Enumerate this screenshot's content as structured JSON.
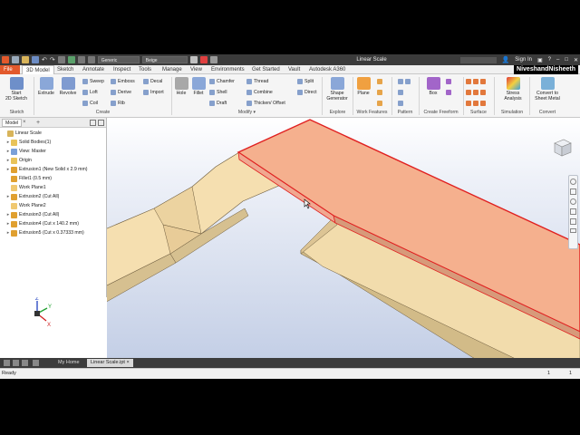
{
  "titlebar": {
    "material": "Generic",
    "appearance": "Beige",
    "doc_title": "Linear Scale",
    "sign_in": "Sign In"
  },
  "tabs": {
    "file": "File",
    "items": [
      "3D Model",
      "Sketch",
      "Annotate",
      "Inspect",
      "Tools",
      "Manage",
      "View",
      "Environments",
      "Get Started",
      "Vault",
      "Autodesk A360"
    ],
    "user": "NiveshandNisheeth"
  },
  "ribbon": {
    "start_sketch": "Start\n2D Sketch",
    "extrude": "Extrude",
    "revolve": "Revolve",
    "sweep": "Sweep",
    "loft": "Loft",
    "coil": "Coil",
    "emboss": "Emboss",
    "derive": "Derive",
    "rib": "Rib",
    "decal": "Decal",
    "import": "Import",
    "hole": "Hole",
    "fillet": "Fillet",
    "chamfer": "Chamfer",
    "shell": "Shell",
    "draft": "Draft",
    "thread": "Thread",
    "combine": "Combine",
    "thicken": "Thicken/ Offset",
    "split": "Split",
    "direct": "Direct",
    "shape_generator": "Shape\nGenerator",
    "plane": "Plane",
    "box": "Box",
    "stress": "Stress\nAnalysis",
    "convert": "Convert to\nSheet Metal",
    "panels": {
      "sketch": "Sketch",
      "create": "Create",
      "modify": "Modify ▾",
      "explore": "Explore",
      "work_features": "Work Features",
      "pattern": "Pattern",
      "freeform": "Create Freeform",
      "surface": "Surface",
      "simulation": "Simulation",
      "convert": "Convert"
    }
  },
  "browser": {
    "tab": "Model",
    "tree": [
      {
        "label": "Linear Scale",
        "indent": 0,
        "icon": "part",
        "expander": ""
      },
      {
        "label": "Solid Bodies(1)",
        "indent": 1,
        "icon": "folder",
        "expander": "▸"
      },
      {
        "label": "View: Master",
        "indent": 1,
        "icon": "view",
        "expander": "▸"
      },
      {
        "label": "Origin",
        "indent": 1,
        "icon": "folder",
        "expander": "▸"
      },
      {
        "label": "Extrusion1 (New Solid x 2.9 mm)",
        "indent": 1,
        "icon": "feature",
        "expander": "▸"
      },
      {
        "label": "Fillet1 (0.5 mm)",
        "indent": 1,
        "icon": "feature",
        "expander": ""
      },
      {
        "label": "Work Plane1",
        "indent": 1,
        "icon": "plane",
        "expander": ""
      },
      {
        "label": "Extrusion2 (Cut All)",
        "indent": 1,
        "icon": "feature",
        "expander": "▸"
      },
      {
        "label": "Work Plane2",
        "indent": 1,
        "icon": "plane",
        "expander": ""
      },
      {
        "label": "Extrusion3 (Cut All)",
        "indent": 1,
        "icon": "feature",
        "expander": "▸"
      },
      {
        "label": "Extrusion4 (Cut x 140.2 mm)",
        "indent": 1,
        "icon": "feature",
        "expander": "▸"
      },
      {
        "label": "Extrusion5 (Cut x 0.37333 mm)",
        "indent": 1,
        "icon": "feature",
        "expander": "▸"
      }
    ]
  },
  "doc_tabs": {
    "home": "My Home",
    "active": "Linear Scale.ipt",
    "close": "×"
  },
  "status": {
    "ready": "Ready",
    "count1": "1",
    "count2": "1"
  },
  "colors": {
    "accent": "#e2592c",
    "body": "#f5dfb0",
    "highlight_face": "#f5b08e",
    "highlight_edge": "#e02020",
    "viewport_top": "#ffffff",
    "viewport_bottom": "#c9d3e8"
  }
}
